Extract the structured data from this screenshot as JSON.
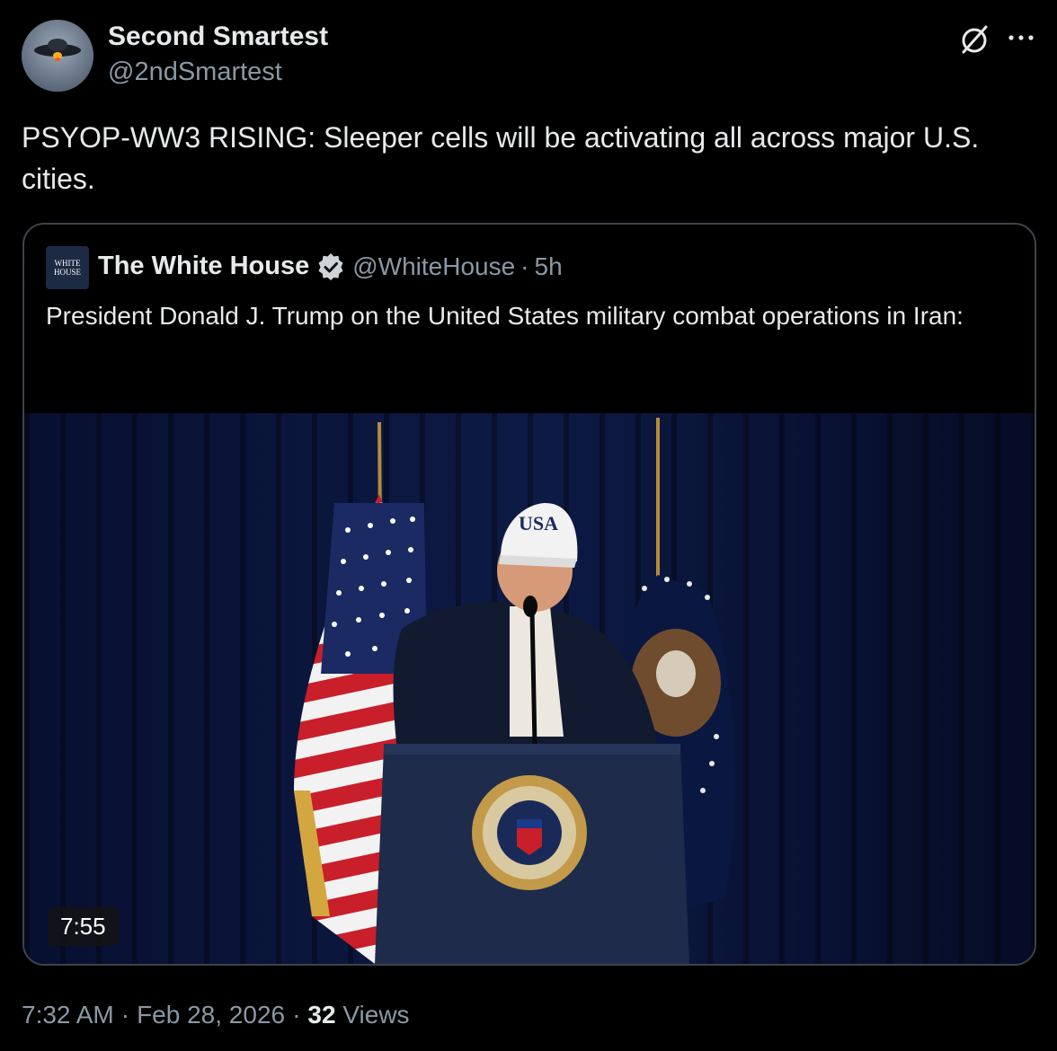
{
  "author": {
    "name": "Second Smartest",
    "handle": "@2ndSmartest"
  },
  "tweet": {
    "text": "PSYOP-WW3 RISING: Sleeper cells will be activating all across major U.S. cities."
  },
  "quote": {
    "avatar_text": "WHITE HOUSE",
    "name": "The White House",
    "handle": "@WhiteHouse",
    "dot": "·",
    "time": "5h",
    "text": "President Donald J. Trump on the United States military combat operations in Iran:",
    "video": {
      "duration": "7:55",
      "cap_text": "USA"
    }
  },
  "footer": {
    "time": "7:32 AM",
    "sep1": "·",
    "date": "Feb 28, 2026",
    "sep2": "·",
    "views_count": "32",
    "views_label": "Views"
  },
  "colors": {
    "background": "#000000",
    "text": "#e7e9ea",
    "secondary": "#8b98a5",
    "border": "#3d4349",
    "gold_badge": "#e2b719"
  }
}
